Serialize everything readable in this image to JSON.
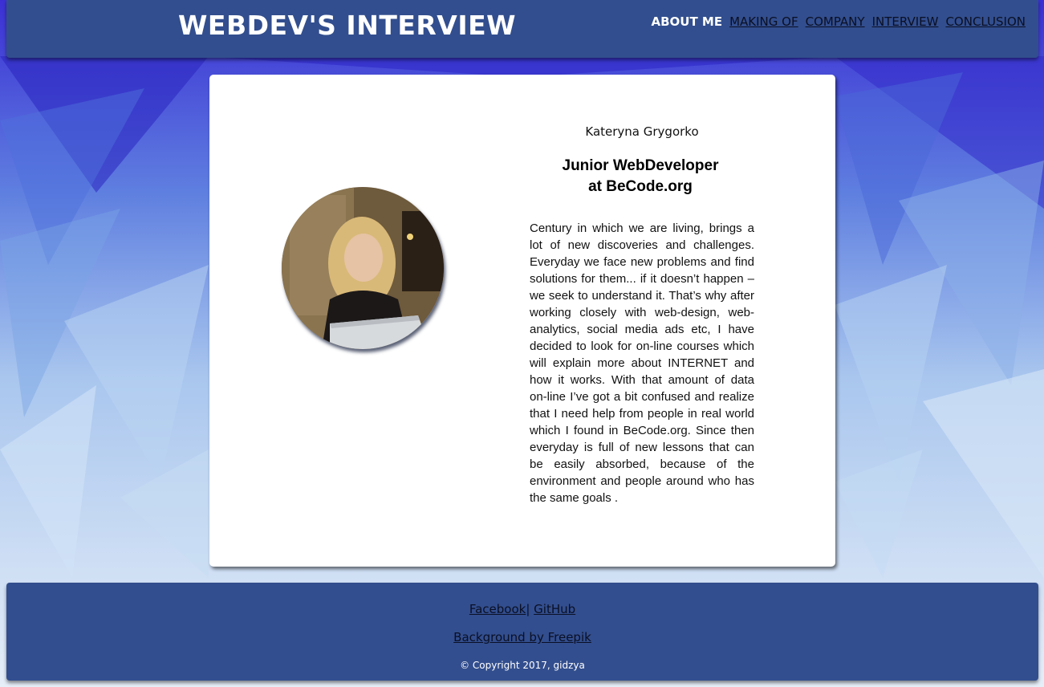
{
  "header": {
    "site_title": "WEBDEV'S INTERVIEW",
    "nav": [
      {
        "label": "ABOUT ME",
        "active": true
      },
      {
        "label": "MAKING OF"
      },
      {
        "label": "COMPANY"
      },
      {
        "label": "INTERVIEW"
      },
      {
        "label": "CONCLUSION"
      }
    ]
  },
  "profile": {
    "name": "Kateryna Grygorko",
    "role_line1": "Junior WebDeveloper",
    "role_line2": "at BeCode.org",
    "bio": "Century in which we are living, brings a lot of new discoveries and challenges. Everyday we face new problems and find solutions for them... if it doesn’t happen – we seek to understand it. That’s why after working closely with web-design, web-analytics, social media ads etc, I have decided to look for on-line courses which will explain more about INTERNET and how it works. With that amount of data on-line I’ve got a bit confused and realize that I need help from people in real world which I found in BeCode.org. Since then everyday is full of new lessons that can be easily absorbed, because of the environment and people around who has the same goals ."
  },
  "footer": {
    "facebook": "Facebook",
    "separator": "|",
    "github": "GitHub",
    "background_credit": "Background by Freepik",
    "copyright": "© Copyright 2017, gidzya"
  },
  "colors": {
    "bar": "#324e8e",
    "background_blue": "#3a2fd6",
    "background_light": "#dfe9f6"
  }
}
